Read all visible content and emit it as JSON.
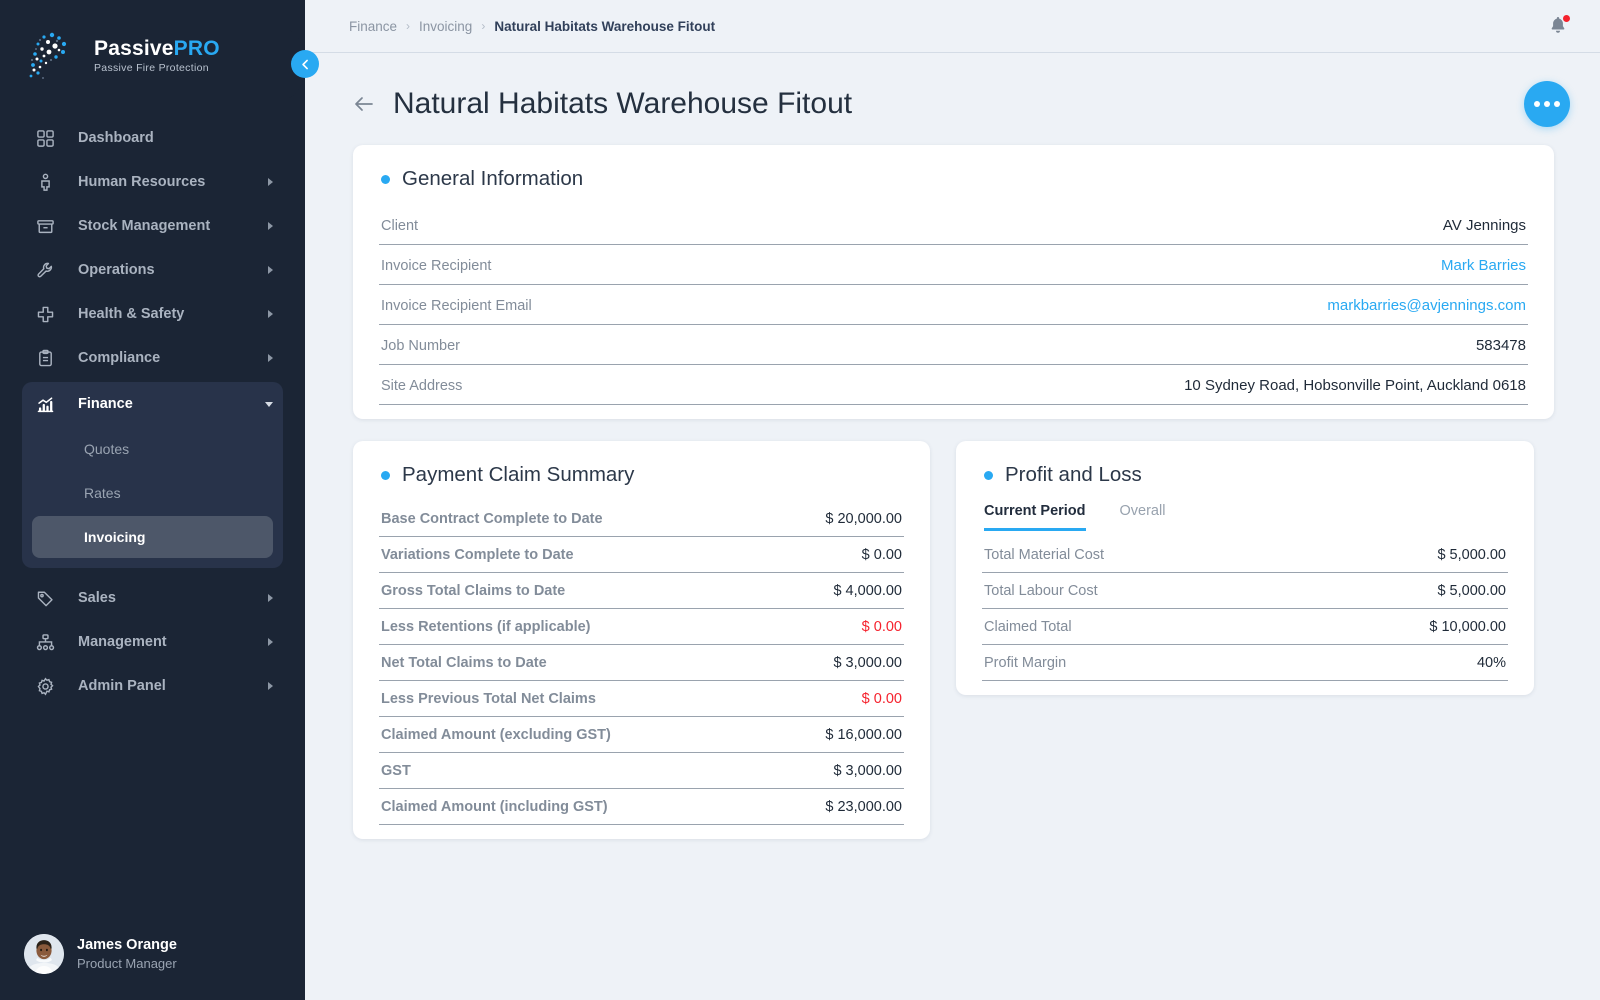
{
  "brand": {
    "name_part1": "Passive",
    "name_part2": "PRO",
    "tagline": "Passive Fire Protection",
    "accent": "#29a9f2",
    "sidebar_bg": "#1b2535"
  },
  "sidebar": {
    "collapse_label": "<",
    "items": [
      {
        "label": "Dashboard",
        "icon": "grid-icon",
        "has_children": false
      },
      {
        "label": "Human Resources",
        "icon": "person-icon",
        "has_children": true
      },
      {
        "label": "Stock Management",
        "icon": "box-icon",
        "has_children": true
      },
      {
        "label": "Operations",
        "icon": "wrench-icon",
        "has_children": true
      },
      {
        "label": "Health & Safety",
        "icon": "medical-cross-icon",
        "has_children": true
      },
      {
        "label": "Compliance",
        "icon": "clipboard-icon",
        "has_children": true
      }
    ],
    "finance_group": {
      "label": "Finance",
      "icon": "chart-bar-icon",
      "expanded": true,
      "children": [
        {
          "label": "Quotes",
          "active": false
        },
        {
          "label": "Rates",
          "active": false
        },
        {
          "label": "Invoicing",
          "active": true
        }
      ]
    },
    "items_after": [
      {
        "label": "Sales",
        "icon": "tag-icon",
        "has_children": true
      },
      {
        "label": "Management",
        "icon": "hierarchy-icon",
        "has_children": true
      },
      {
        "label": "Admin Panel",
        "icon": "gear-icon",
        "has_children": true
      }
    ],
    "user": {
      "name": "James Orange",
      "role": "Product Manager"
    }
  },
  "topbar": {
    "breadcrumb": [
      "Finance",
      "Invoicing",
      "Natural Habitats Warehouse Fitout"
    ],
    "separator": "›",
    "notifications_icon": "bell-icon",
    "has_notification": true
  },
  "page": {
    "title": "Natural Habitats Warehouse Fitout",
    "back_icon": "arrow-left-icon",
    "more_actions_icon": "ellipsis-icon"
  },
  "general_information": {
    "title": "General Information",
    "rows": [
      {
        "label": "Client",
        "value": "AV Jennings",
        "style": "plain"
      },
      {
        "label": "Invoice Recipient",
        "value": "Mark Barries",
        "style": "link"
      },
      {
        "label": "Invoice Recipient Email",
        "value": "markbarries@avjennings.com",
        "style": "link"
      },
      {
        "label": "Job Number",
        "value": "583478",
        "style": "plain"
      },
      {
        "label": "Site Address",
        "value": "10 Sydney Road, Hobsonville Point, Auckland 0618",
        "style": "plain"
      }
    ]
  },
  "payment_claim_summary": {
    "title": "Payment Claim Summary",
    "rows": [
      {
        "label": "Base Contract Complete to Date",
        "value": "$ 20,000.00",
        "style": "plain"
      },
      {
        "label": "Variations Complete to Date",
        "value": "$ 0.00",
        "style": "plain"
      },
      {
        "label": "Gross Total Claims to Date",
        "value": "$ 4,000.00",
        "style": "plain"
      },
      {
        "label": "Less Retentions (if applicable)",
        "value": "$ 0.00",
        "style": "negative"
      },
      {
        "label": "Net Total Claims to Date",
        "value": "$ 3,000.00",
        "style": "plain"
      },
      {
        "label": "Less Previous Total Net Claims",
        "value": "$ 0.00",
        "style": "negative"
      },
      {
        "label": "Claimed Amount (excluding GST)",
        "value": "$ 16,000.00",
        "style": "plain"
      },
      {
        "label": "GST",
        "value": "$ 3,000.00",
        "style": "plain"
      },
      {
        "label": "Claimed Amount (including GST)",
        "value": "$ 23,000.00",
        "style": "plain"
      }
    ]
  },
  "profit_and_loss": {
    "title": "Profit and Loss",
    "tabs": [
      {
        "label": "Current Period",
        "active": true
      },
      {
        "label": "Overall",
        "active": false
      }
    ],
    "rows": [
      {
        "label": "Total Material Cost",
        "value": "$ 5,000.00",
        "style": "plain"
      },
      {
        "label": "Total Labour Cost",
        "value": "$ 5,000.00",
        "style": "plain"
      },
      {
        "label": "Claimed Total",
        "value": "$ 10,000.00",
        "style": "plain"
      },
      {
        "label": "Profit Margin",
        "value": "40%",
        "style": "plain"
      }
    ]
  }
}
